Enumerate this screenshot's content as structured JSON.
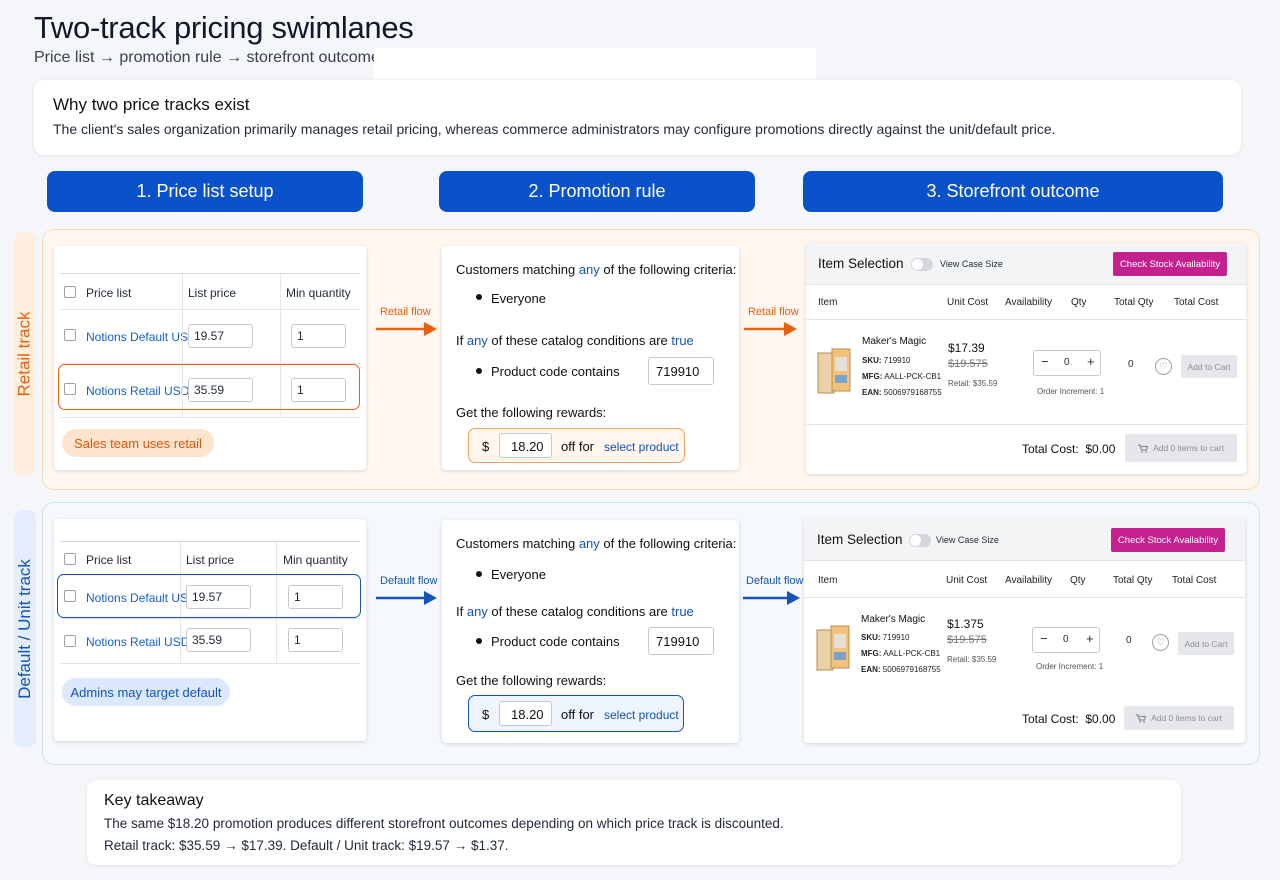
{
  "header": {
    "title": "Two-track pricing swimlanes",
    "subtitle": "Price list → promotion rule → storefront outcome"
  },
  "why": {
    "heading": "Why two price tracks exist",
    "body": "The client's sales organization primarily manages retail pricing, whereas commerce administrators may configure promotions directly against the unit/default price."
  },
  "columns": [
    "1. Price list setup",
    "2. Promotion rule",
    "3. Storefront outcome"
  ],
  "colors": {
    "retail": "#e8600e",
    "default": "#1453b8",
    "header_blue": "#0a52c9",
    "magenta": "#c5218e"
  },
  "price_list": {
    "col_name": "Price list",
    "col_price": "List price",
    "col_min": "Min quantity"
  },
  "promo": {
    "c1a": "Customers matching ",
    "any": "any",
    "c1b": " of the following criteria:",
    "everyone": "Everyone",
    "c2a": "If ",
    "c2b": " of these catalog conditions are ",
    "true": "true",
    "product_code": "Product code contains",
    "code_value": "719910",
    "rewards": "Get the following rewards:",
    "dollar": "$",
    "amount": "18.20",
    "off_for": "off for",
    "select_product": "select product"
  },
  "store": {
    "item_selection": "Item Selection",
    "view_case": "View Case Size",
    "check_stock": "Check Stock Availability",
    "cols": [
      "Item",
      "Unit Cost",
      "Availability",
      "Qty",
      "Total Qty",
      "Total Cost"
    ],
    "product": "Maker's Magic",
    "sku_lbl": "SKU:",
    "sku": "719910",
    "mfg_lbl": "MFG:",
    "mfg": "AALL-PCK-CB1",
    "ean_lbl": "EAN:",
    "ean": "5006979168755",
    "qty": "0",
    "total_qty": "0",
    "order_inc": "Order Increment: 1",
    "add_to_cart": "Add to Cart",
    "total_cost_lbl": "Total Cost:",
    "total_cost": "$0.00",
    "add_items": "Add 0 items to cart",
    "minus": "−",
    "plus": "+"
  },
  "retail": {
    "lane": "Retail track",
    "arrow": "Retail flow",
    "rows": [
      {
        "name": "Notions Default USD",
        "price": "19.57",
        "min": "1"
      },
      {
        "name": "Notions Retail USD",
        "price": "35.59",
        "min": "1"
      }
    ],
    "pill": "Sales team uses retail",
    "unit": "$17.39",
    "orig": "$19.575",
    "retail": "Retail: $35.59"
  },
  "default": {
    "lane": "Default / Unit track",
    "arrow": "Default flow",
    "rows": [
      {
        "name": "Notions Default USD",
        "price": "19.57",
        "min": "1"
      },
      {
        "name": "Notions Retail USD",
        "price": "35.59",
        "min": "1"
      }
    ],
    "pill": "Admins may target default",
    "unit": "$1.375",
    "orig": "$19.575",
    "retail": "Retail: $35.59"
  },
  "takeaway": {
    "heading": "Key takeaway",
    "line1": "The same $18.20 promotion produces different storefront outcomes depending on which price track is discounted.",
    "line2": "Retail track: $35.59 → $17.39. Default / Unit track: $19.57 → $1.37."
  }
}
